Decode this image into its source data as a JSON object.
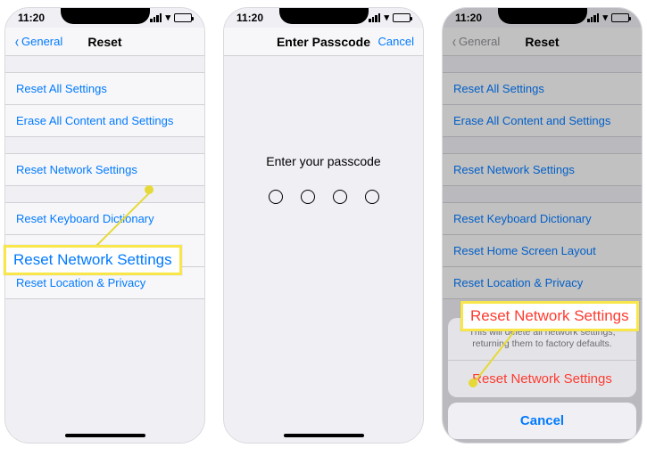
{
  "status": {
    "time": "11:20",
    "location_arrow": "➤"
  },
  "reset_screen": {
    "back_label": "General",
    "title": "Reset",
    "options": [
      "Reset All Settings",
      "Erase All Content and Settings",
      "Reset Network Settings",
      "Reset Keyboard Dictionary",
      "Reset Home Screen Layout",
      "Reset Location & Privacy"
    ]
  },
  "passcode_screen": {
    "title": "Enter Passcode",
    "cancel": "Cancel",
    "prompt": "Enter your passcode"
  },
  "action_sheet": {
    "description": "This will delete all network settings, returning them to factory defaults.",
    "destructive": "Reset Network Settings",
    "cancel": "Cancel"
  },
  "callouts": {
    "first": "Reset Network Settings",
    "second": "Reset Network Settings"
  }
}
